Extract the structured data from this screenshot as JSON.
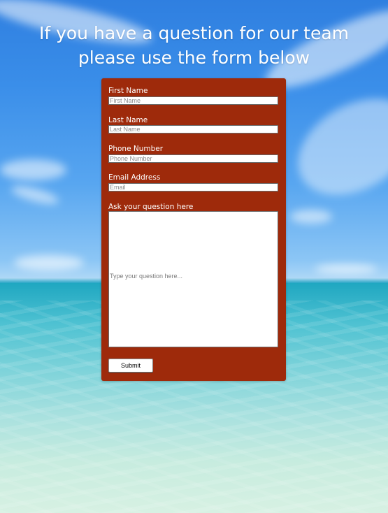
{
  "heading": {
    "line1": "If you have a question for our team",
    "line2": "please use the form below"
  },
  "form": {
    "first_name": {
      "label": "First Name",
      "placeholder": "First Name",
      "value": ""
    },
    "last_name": {
      "label": "Last Name",
      "placeholder": "Last Name",
      "value": ""
    },
    "phone": {
      "label": "Phone Number",
      "placeholder": "Phone Number",
      "value": ""
    },
    "email": {
      "label": "Email Address",
      "placeholder": "Email",
      "value": ""
    },
    "question": {
      "label": "Ask your question here",
      "placeholder": "Type your question here...",
      "value": ""
    },
    "submit_label": "Submit"
  },
  "colors": {
    "panel": "#9e2a0b",
    "label_text": "#ffffff",
    "heading_text": "#ffffff"
  }
}
